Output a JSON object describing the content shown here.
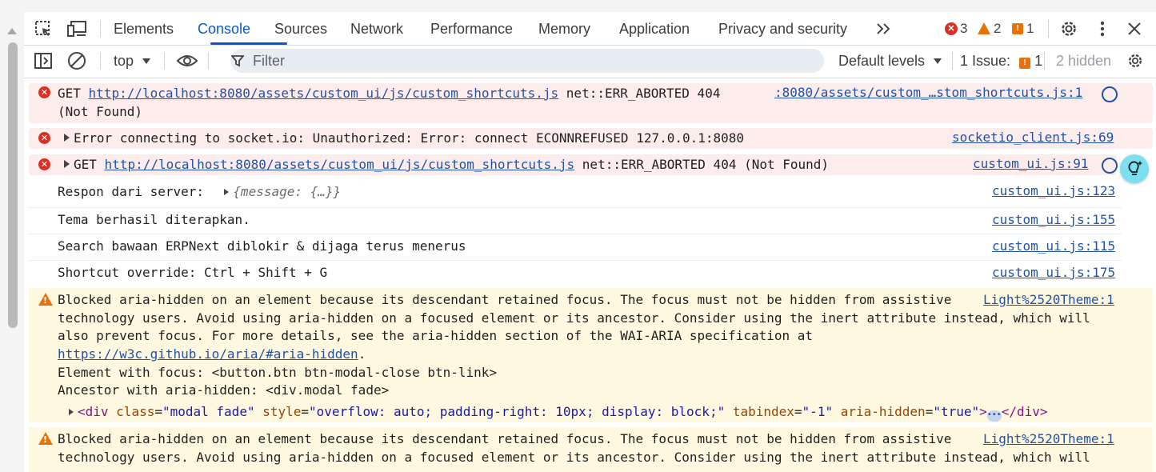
{
  "tabs": [
    {
      "label": "Elements"
    },
    {
      "label": "Console"
    },
    {
      "label": "Sources"
    },
    {
      "label": "Network"
    },
    {
      "label": "Performance"
    },
    {
      "label": "Memory"
    },
    {
      "label": "Application"
    },
    {
      "label": "Privacy and security"
    }
  ],
  "counts": {
    "errors": "3",
    "warnings": "2",
    "issues": "1"
  },
  "toolbar": {
    "context": "top",
    "filter_placeholder": "Filter",
    "levels": "Default levels",
    "issues_label": "1 Issue:",
    "issues_count": "1",
    "hidden": "2 hidden"
  },
  "messages": {
    "m1": {
      "method": "GET",
      "url": "http://localhost:8080/assets/custom_ui/js/custom_shortcuts.js",
      "status": "net::ERR_ABORTED 404",
      "status2": "(Not Found)",
      "source": ":8080/assets/custom_…stom_shortcuts.js:1"
    },
    "m2": {
      "text": "Error connecting to socket.io: Unauthorized: Error: connect ECONNREFUSED 127.0.0.1:8080",
      "source": "socketio_client.js:69"
    },
    "m3": {
      "method": "GET",
      "url": "http://localhost:8080/assets/custom_ui/js/custom_shortcuts.js",
      "status": "net::ERR_ABORTED 404 (Not Found)",
      "source": "custom_ui.js:91"
    },
    "m4": {
      "text": "Respon dari server:",
      "object": "{message: {…}}",
      "source": "custom_ui.js:123"
    },
    "m5": {
      "text": "Tema berhasil diterapkan.",
      "source": "custom_ui.js:155"
    },
    "m6": {
      "text": "Search bawaan ERPNext diblokir & dijaga terus menerus",
      "source": "custom_ui.js:115"
    },
    "m7": {
      "text": "Shortcut override: Ctrl + Shift + G",
      "source": "custom_ui.js:175"
    },
    "w1": {
      "line1": "Blocked aria-hidden on an element because its descendant retained focus. The focus must not be hidden from assistive",
      "line2": "technology users. Avoid using aria-hidden on a focused element or its ancestor. Consider using the inert attribute instead, which will",
      "line3": "also prevent focus. For more details, see the aria-hidden section of the WAI-ARIA specification at",
      "link": "https://w3c.github.io/aria/#aria-hidden",
      "line5": "Element with focus: <button.btn btn-modal-close btn-link>",
      "line6": "Ancestor with aria-hidden: <div.modal fade>",
      "node_open": "<div",
      "attr_class": "class",
      "val_class": "\"modal fade\"",
      "attr_style": "style",
      "val_style": "\"overflow: auto; padding-right: 10px; display: block;\"",
      "attr_tab": "tabindex",
      "val_tab": "\"-1\"",
      "attr_aria": "aria-hidden",
      "val_aria": "\"true\"",
      "node_close": "</div>",
      "source": "Light%2520Theme:1"
    },
    "w2": {
      "line1": "Blocked aria-hidden on an element because its descendant retained focus. The focus must not be hidden from assistive",
      "line2": "technology users. Avoid using aria-hidden on a focused element or its ancestor. Consider using the inert attribute instead, which will",
      "source": "Light%2520Theme:1"
    }
  },
  "colors": {
    "accent": "#0b57d0",
    "error": "#d93025",
    "warning": "#e8710a",
    "link": "#1f53a8"
  }
}
